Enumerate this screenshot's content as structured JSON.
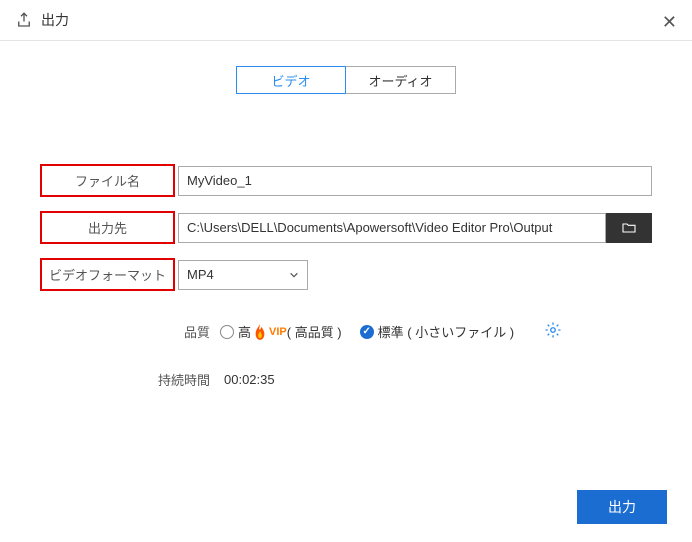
{
  "header": {
    "title": "出力"
  },
  "tabs": {
    "video": "ビデオ",
    "audio": "オーディオ"
  },
  "form": {
    "filename_label": "ファイル名",
    "filename_value": "MyVideo_1",
    "output_label": "出力先",
    "output_value": "C:\\Users\\DELL\\Documents\\Apowersoft\\Video Editor Pro\\Output",
    "format_label": "ビデオフォーマット",
    "format_value": "MP4"
  },
  "quality": {
    "label": "品質",
    "high_label": "高",
    "vip_text": "VIP",
    "high_suffix": " ( 高品質 )",
    "standard_label": "標準 ( 小さいファイル )"
  },
  "duration": {
    "label": "持続時間",
    "value": "00:02:35"
  },
  "footer": {
    "export_label": "出力"
  }
}
